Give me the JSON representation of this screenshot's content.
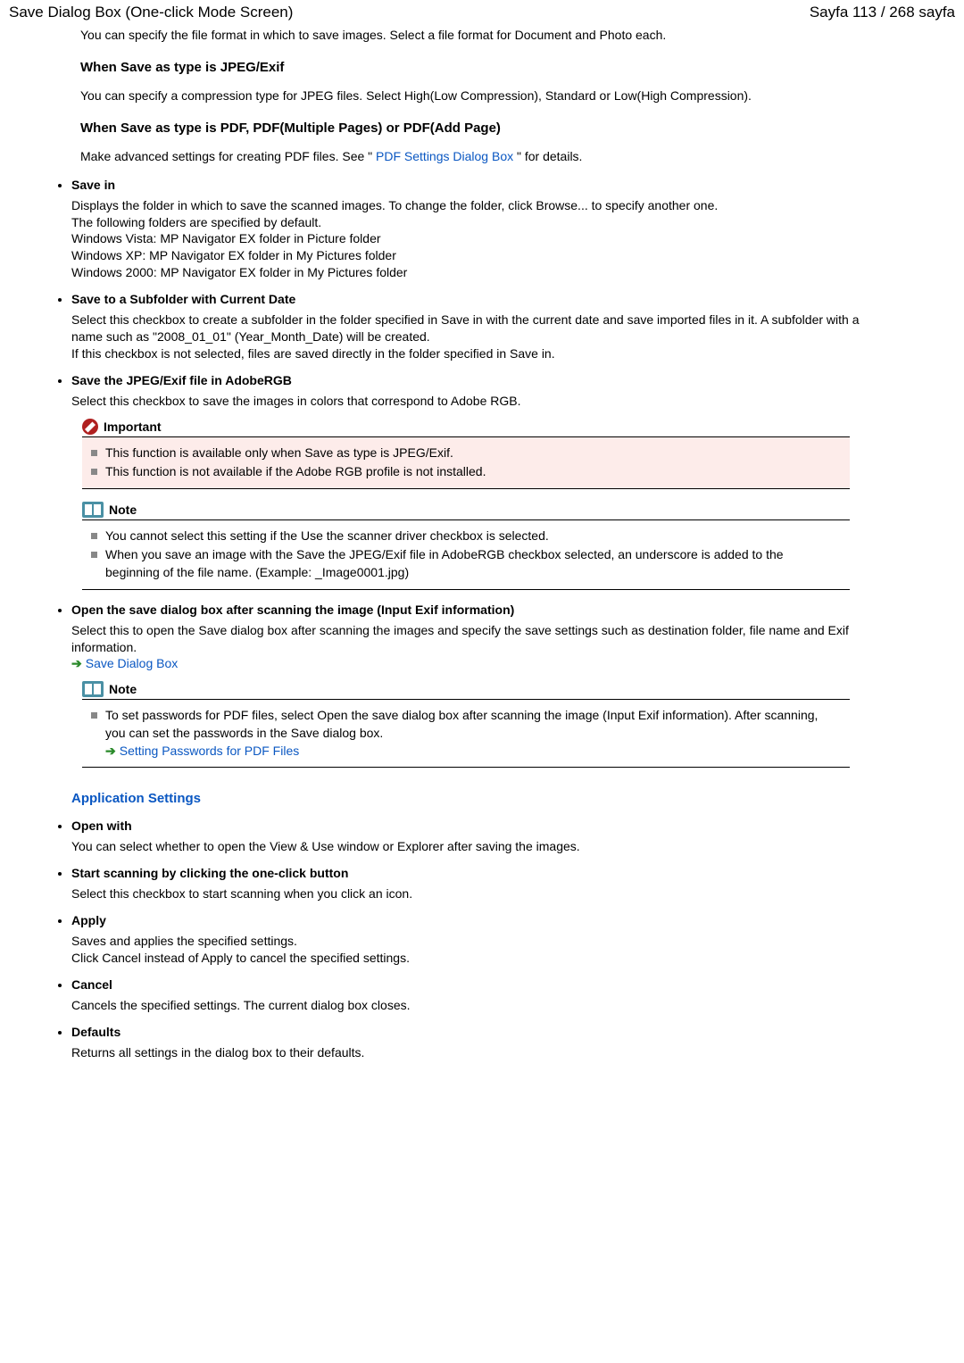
{
  "header": {
    "title": "Save Dialog Box (One-click Mode Screen)",
    "page_counter": "Sayfa 113 / 268 sayfa"
  },
  "intro": "You can specify the file format in which to save images. Select a file format for Document and Photo each.",
  "jpeg": {
    "heading": "When Save as type is JPEG/Exif",
    "body": "You can specify a compression type for JPEG files. Select High(Low Compression), Standard or Low(High Compression)."
  },
  "pdf": {
    "heading": "When Save as type is PDF, PDF(Multiple Pages) or PDF(Add Page)",
    "text_before": "Make advanced settings for creating PDF files. See \"",
    "link": " PDF Settings Dialog Box ",
    "text_after": "\" for details."
  },
  "save_in": {
    "title": "Save in",
    "line1": "Displays the folder in which to save the scanned images. To change the folder, click Browse... to specify another one.",
    "line2": "The following folders are specified by default.",
    "line3": "Windows Vista: MP Navigator EX folder in Picture folder",
    "line4": "Windows XP: MP Navigator EX folder in My Pictures folder",
    "line5": "Windows 2000: MP Navigator EX folder in My Pictures folder"
  },
  "subfolder": {
    "title": "Save to a Subfolder with Current Date",
    "line1": "Select this checkbox to create a subfolder in the folder specified in Save in with the current date and save imported files in it. A subfolder with a name such as \"2008_01_01\" (Year_Month_Date) will be created.",
    "line2": "If this checkbox is not selected, files are saved directly in the folder specified in Save in."
  },
  "adobergb": {
    "title": "Save the JPEG/Exif file in AdobeRGB",
    "body": "Select this checkbox to save the images in colors that correspond to Adobe RGB.",
    "important_label": "Important",
    "imp1": "This function is available only when Save as type is JPEG/Exif.",
    "imp2": "This function is not available if the Adobe RGB profile is not installed.",
    "note_label": "Note",
    "note1": "You cannot select this setting if the Use the scanner driver checkbox is selected.",
    "note2": "When you save an image with the Save the JPEG/Exif file in AdobeRGB checkbox selected, an underscore is added to the beginning of the file name. (Example: _Image0001.jpg)"
  },
  "open_save": {
    "title": "Open the save dialog box after scanning the image (Input Exif information)",
    "body": "Select this to open the Save dialog box after scanning the images and specify the save settings such as destination folder, file name and Exif information.",
    "link": "Save Dialog Box",
    "note_label": "Note",
    "note1": "To set passwords for PDF files, select Open the save dialog box after scanning the image (Input Exif information). After scanning, you can set the passwords in the Save dialog box.",
    "note_link": "Setting Passwords for PDF Files"
  },
  "app_settings": {
    "heading": "Application Settings",
    "open_with_title": "Open with",
    "open_with_body": "You can select whether to open the View & Use window or Explorer after saving the images.",
    "start_title": "Start scanning by clicking the one-click button",
    "start_body": "Select this checkbox to start scanning when you click an icon.",
    "apply_title": "Apply",
    "apply_line1": "Saves and applies the specified settings.",
    "apply_line2": "Click Cancel instead of Apply to cancel the specified settings.",
    "cancel_title": "Cancel",
    "cancel_body": "Cancels the specified settings. The current dialog box closes.",
    "defaults_title": "Defaults",
    "defaults_body": "Returns all settings in the dialog box to their defaults."
  }
}
